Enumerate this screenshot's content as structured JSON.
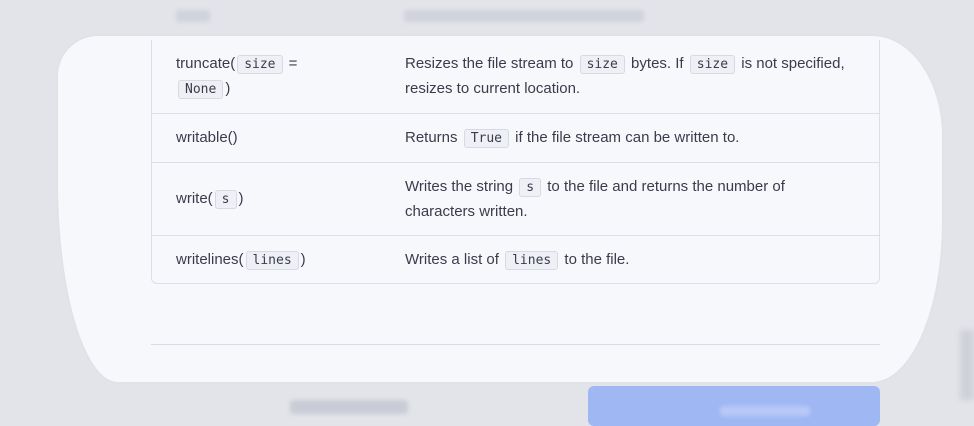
{
  "methods": [
    {
      "signature_prefix": "truncate(",
      "param": "size",
      "signature_middle": " =",
      "default": "None",
      "signature_suffix": ")",
      "desc_parts": [
        "Resizes the file stream to ",
        "size",
        " bytes. If ",
        "size",
        " is not specified, resizes to current location."
      ]
    },
    {
      "signature": "writable()",
      "desc_parts": [
        "Returns ",
        "True",
        " if the file stream can be written to."
      ]
    },
    {
      "signature_prefix": "write(",
      "param": "s",
      "signature_suffix": ")",
      "desc_parts": [
        "Writes the string ",
        "s",
        " to the file and returns the number of characters written."
      ]
    },
    {
      "signature_prefix": "writelines(",
      "param": "lines",
      "signature_suffix": ")",
      "desc_parts": [
        "Writes a list of ",
        "lines",
        " to the file."
      ]
    }
  ]
}
